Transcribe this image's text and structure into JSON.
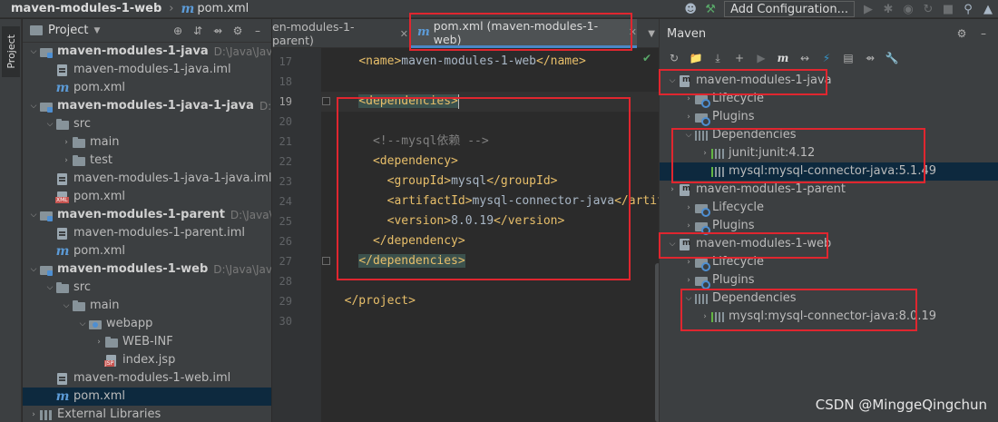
{
  "breadcrumb": {
    "project": "maven-modules-1-web",
    "file": "pom.xml"
  },
  "navbar": {
    "config_label": "Add Configuration..."
  },
  "tool_strip": {
    "project_tab": "Project"
  },
  "project_panel": {
    "title": "Project",
    "rows": [
      {
        "depth": 0,
        "arrow": "▾",
        "icon": "module",
        "label": "maven-modules-1-java",
        "bold": true,
        "path": "D:\\Java\\JavaPro"
      },
      {
        "depth": 1,
        "arrow": "",
        "icon": "iml",
        "label": "maven-modules-1-java.iml"
      },
      {
        "depth": 1,
        "arrow": "",
        "icon": "m",
        "label": "pom.xml"
      },
      {
        "depth": 0,
        "arrow": "▾",
        "icon": "module",
        "label": "maven-modules-1-java-1-java",
        "bold": true,
        "path": "D:\\Java\\"
      },
      {
        "depth": 1,
        "arrow": "▾",
        "icon": "folder",
        "label": "src"
      },
      {
        "depth": 2,
        "arrow": "›",
        "icon": "folder",
        "label": "main"
      },
      {
        "depth": 2,
        "arrow": "›",
        "icon": "folder",
        "label": "test"
      },
      {
        "depth": 1,
        "arrow": "",
        "icon": "iml",
        "label": "maven-modules-1-java-1-java.iml"
      },
      {
        "depth": 1,
        "arrow": "",
        "icon": "xml",
        "label": "pom.xml"
      },
      {
        "depth": 0,
        "arrow": "▾",
        "icon": "module",
        "label": "maven-modules-1-parent",
        "bold": true,
        "path": "D:\\Java\\Java"
      },
      {
        "depth": 1,
        "arrow": "",
        "icon": "iml",
        "label": "maven-modules-1-parent.iml"
      },
      {
        "depth": 1,
        "arrow": "",
        "icon": "m",
        "label": "pom.xml"
      },
      {
        "depth": 0,
        "arrow": "▾",
        "icon": "module",
        "label": "maven-modules-1-web",
        "bold": true,
        "path": "D:\\Java\\Java"
      },
      {
        "depth": 1,
        "arrow": "▾",
        "icon": "folder",
        "label": "src"
      },
      {
        "depth": 2,
        "arrow": "▾",
        "icon": "folder",
        "label": "main"
      },
      {
        "depth": 3,
        "arrow": "▾",
        "icon": "web",
        "label": "webapp"
      },
      {
        "depth": 4,
        "arrow": "›",
        "icon": "folder",
        "label": "WEB-INF"
      },
      {
        "depth": 4,
        "arrow": "",
        "icon": "jsp",
        "label": "index.jsp"
      },
      {
        "depth": 1,
        "arrow": "",
        "icon": "iml",
        "label": "maven-modules-1-web.iml"
      },
      {
        "depth": 1,
        "arrow": "",
        "icon": "m",
        "label": "pom.xml",
        "selected": true
      },
      {
        "depth": 0,
        "arrow": "›",
        "icon": "lib",
        "label": "External Libraries"
      }
    ]
  },
  "editor": {
    "tabs": [
      {
        "label": "en-modules-1-parent)",
        "active": false
      },
      {
        "label": "pom.xml (maven-modules-1-web)",
        "active": true
      }
    ],
    "line_numbers": [
      "17",
      "18",
      "19",
      "20",
      "21",
      "22",
      "23",
      "24",
      "25",
      "26",
      "27",
      "28",
      "29",
      "30"
    ],
    "lines": [
      [
        {
          "t": "    "
        },
        {
          "c": "tag",
          "t": "<name>"
        },
        {
          "t": "maven-modules-1-web"
        },
        {
          "c": "tag",
          "t": "</name>"
        }
      ],
      [],
      [
        {
          "t": "    "
        },
        {
          "c": "tag hl",
          "t": "<dependencies>"
        },
        {
          "caret": true
        }
      ],
      [],
      [
        {
          "t": "      "
        },
        {
          "c": "cmt",
          "t": "<!--mysql依赖 -->"
        }
      ],
      [
        {
          "t": "      "
        },
        {
          "c": "tag",
          "t": "<dependency>"
        }
      ],
      [
        {
          "t": "        "
        },
        {
          "c": "tag",
          "t": "<groupId>"
        },
        {
          "t": "mysql"
        },
        {
          "c": "tag",
          "t": "</groupId>"
        }
      ],
      [
        {
          "t": "        "
        },
        {
          "c": "tag",
          "t": "<artifactId>"
        },
        {
          "t": "mysql-connector-java"
        },
        {
          "c": "tag",
          "t": "</artifa"
        }
      ],
      [
        {
          "t": "        "
        },
        {
          "c": "tag",
          "t": "<version>"
        },
        {
          "t": "8.0.19"
        },
        {
          "c": "tag",
          "t": "</version>"
        }
      ],
      [
        {
          "t": "      "
        },
        {
          "c": "tag",
          "t": "</dependency>"
        }
      ],
      [
        {
          "t": "    "
        },
        {
          "c": "tag hl",
          "t": "</dependencies>"
        }
      ],
      [],
      [
        {
          "t": "  "
        },
        {
          "c": "tag",
          "t": "</project>"
        }
      ],
      []
    ]
  },
  "maven": {
    "title": "Maven",
    "rows": [
      {
        "depth": 0,
        "arrow": "▾",
        "icon": "proj",
        "label": "maven-modules-1-java"
      },
      {
        "depth": 1,
        "arrow": "›",
        "icon": "gear",
        "label": "Lifecycle"
      },
      {
        "depth": 1,
        "arrow": "›",
        "icon": "gear",
        "label": "Plugins"
      },
      {
        "depth": 1,
        "arrow": "▾",
        "icon": "bars",
        "label": "Dependencies"
      },
      {
        "depth": 2,
        "arrow": "›",
        "icon": "lib",
        "label": "junit:junit:4.12"
      },
      {
        "depth": 2,
        "arrow": "",
        "icon": "lib",
        "label": "mysql:mysql-connector-java:5.1.49",
        "selected": true
      },
      {
        "depth": 0,
        "arrow": "›",
        "icon": "proj",
        "label": "maven-modules-1-parent"
      },
      {
        "depth": 1,
        "arrow": "›",
        "icon": "gear",
        "label": "Lifecycle"
      },
      {
        "depth": 1,
        "arrow": "›",
        "icon": "gear",
        "label": "Plugins"
      },
      {
        "depth": 0,
        "arrow": "▾",
        "icon": "proj",
        "label": "maven-modules-1-web"
      },
      {
        "depth": 1,
        "arrow": "›",
        "icon": "gear",
        "label": "Lifecycle"
      },
      {
        "depth": 1,
        "arrow": "›",
        "icon": "gear",
        "label": "Plugins"
      },
      {
        "depth": 1,
        "arrow": "▾",
        "icon": "bars",
        "label": "Dependencies"
      },
      {
        "depth": 2,
        "arrow": "›",
        "icon": "lib",
        "label": "mysql:mysql-connector-java:8.0.19"
      }
    ]
  },
  "watermark": "CSDN @MinggeQingchun",
  "colors": {
    "annotation": "#e0262f",
    "accent": "#4a88c7",
    "selection": "#0d293e"
  }
}
